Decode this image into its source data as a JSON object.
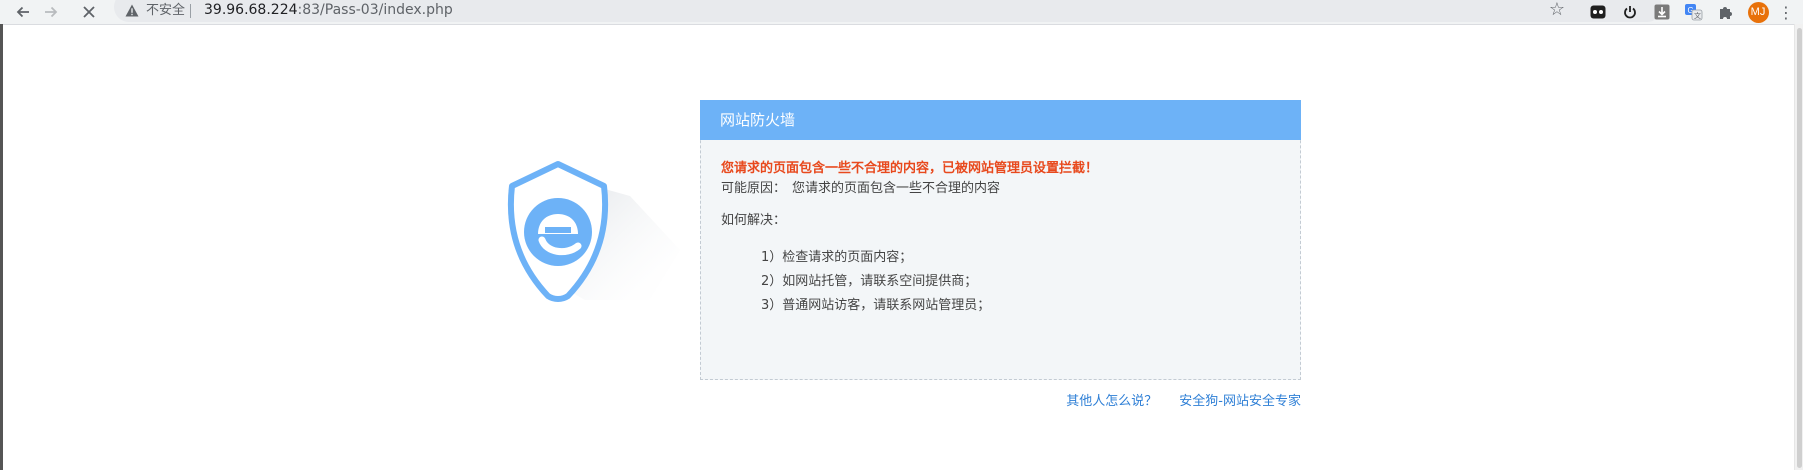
{
  "browser": {
    "security_label": "不安全",
    "url_host": "39.96.68.224",
    "url_path": ":83/Pass-03/index.php",
    "profile_initials": "MJ",
    "colors": {
      "avatar": "#e8710a",
      "toolbar_bg": "#f1f3f4"
    },
    "extension_icons": [
      "tabs-extension-icon",
      "power-extension-icon",
      "download-extension-icon",
      "translate-extension-icon",
      "puzzle-extensions-icon"
    ]
  },
  "page": {
    "panel_title": "网站防火墙",
    "warning": "您请求的页面包含一些不合理的内容，已被网站管理员设置拦截！",
    "reason_label": "可能原因：",
    "reason_text": "您请求的页面包含一些不合理的内容",
    "howto_label": "如何解决：",
    "steps": [
      "1）检查请求的页面内容；",
      "2）如网站托管，请联系空间提供商；",
      "3）普通网站访客，请联系网站管理员；"
    ],
    "links": {
      "others_say": "其他人怎么说？",
      "vendor": "安全狗-网站安全专家"
    },
    "colors": {
      "header_bg": "#6db2f7",
      "warning_text": "#e8491d",
      "link": "#2e7fd6",
      "logo": "#6db2f7"
    }
  }
}
